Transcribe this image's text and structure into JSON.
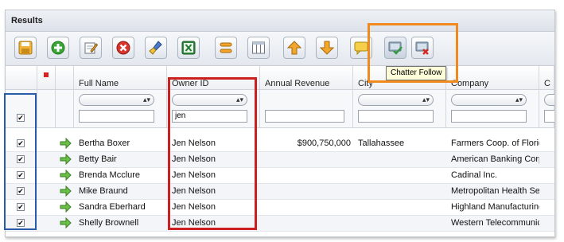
{
  "panel": {
    "title": "Results"
  },
  "toolbar": {
    "buttons": [
      {
        "icon": "save-icon"
      },
      {
        "icon": "add-icon"
      },
      {
        "icon": "edit-icon"
      },
      {
        "icon": "delete-icon"
      },
      {
        "icon": "clean-icon"
      },
      {
        "icon": "excel-export-icon"
      },
      {
        "icon": "refresh-icon"
      },
      {
        "icon": "columns-icon"
      },
      {
        "icon": "move-up-icon"
      },
      {
        "icon": "move-down-icon"
      },
      {
        "icon": "chatter-post-icon"
      },
      {
        "icon": "chatter-follow-icon"
      },
      {
        "icon": "chatter-unfollow-icon"
      }
    ],
    "tooltip": "Chatter Follow"
  },
  "columns": {
    "full_name": "Full Name",
    "owner_id": "Owner ID",
    "annual_revenue": "Annual Revenue",
    "city": "City",
    "company": "Company",
    "extra": "C"
  },
  "filters": {
    "owner_id_text": "jen"
  },
  "rows": [
    {
      "name": "Bertha Boxer",
      "owner": "Jen Nelson",
      "revenue": "$900,750,000",
      "city": "Tallahassee",
      "company": "Farmers Coop. of Florida"
    },
    {
      "name": "Betty Bair",
      "owner": "Jen Nelson",
      "revenue": "",
      "city": "",
      "company": "American Banking Corp."
    },
    {
      "name": "Brenda Mcclure",
      "owner": "Jen Nelson",
      "revenue": "",
      "city": "",
      "company": "Cadinal Inc."
    },
    {
      "name": "Mike Braund",
      "owner": "Jen Nelson",
      "revenue": "",
      "city": "",
      "company": "Metropolitan Health Services"
    },
    {
      "name": "Sandra Eberhard",
      "owner": "Jen Nelson",
      "revenue": "",
      "city": "",
      "company": "Highland Manufacturing Ltd."
    },
    {
      "name": "Shelly Brownell",
      "owner": "Jen Nelson",
      "revenue": "",
      "city": "",
      "company": "Western Telecommunications"
    }
  ],
  "colors": {
    "blue_highlight": "#2a5ba8",
    "red_highlight": "#cc1f1f",
    "orange_highlight": "#f08a1f"
  }
}
